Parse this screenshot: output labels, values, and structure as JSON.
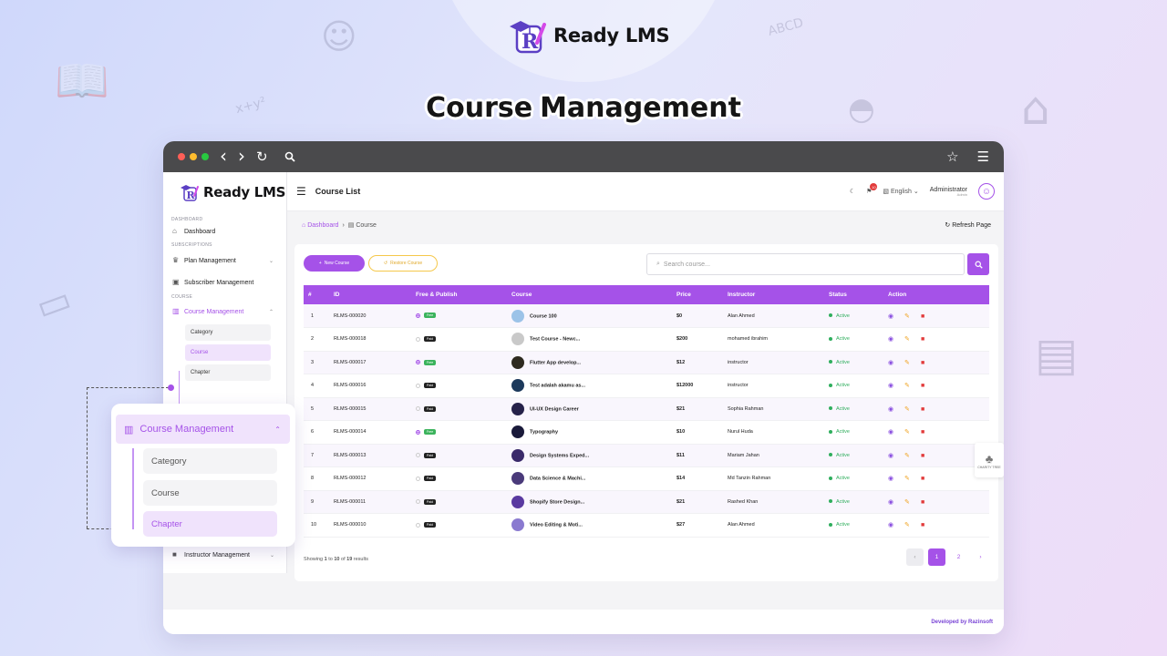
{
  "brand": {
    "name": "Ready LMS"
  },
  "hero": {
    "title_1": "Course",
    "title_2": "Management"
  },
  "browser": {
    "back": "‹",
    "forward": "›"
  },
  "sidebar": {
    "brand": "Ready LMS",
    "sections": {
      "dashboard": "DASHBOARD",
      "subscriptions": "SUBSCRIPTIONS",
      "course": "COURSE"
    },
    "items": {
      "dashboard": "Dashboard",
      "plan": "Plan Management",
      "subscriber": "Subscriber Management",
      "course_mgmt": "Course Management",
      "instructor": "Instructor Management"
    },
    "subitems": [
      "Category",
      "Course",
      "Chapter"
    ]
  },
  "topbar": {
    "title": "Course List",
    "notif_count": "10",
    "language": "English",
    "admin_name": "Administrator",
    "admin_role": "Admin"
  },
  "breadcrumb": {
    "home": "Dashboard",
    "current": "Course"
  },
  "refresh_label": "Refresh Page",
  "toolbar": {
    "new_course": "New Course",
    "restore_course": "Restore Course",
    "search_placeholder": "Search course..."
  },
  "table": {
    "headers": [
      "#",
      "ID",
      "Free & Publish",
      "Course",
      "Price",
      "Instructor",
      "Status",
      "Action"
    ],
    "rows": [
      {
        "n": "1",
        "id": "RLMS-000020",
        "publish": true,
        "pill": "Free",
        "course": "Course 100",
        "price": "$0",
        "instructor": "Alan Ahmed",
        "status": "Active"
      },
      {
        "n": "2",
        "id": "RLMS-000018",
        "publish": false,
        "pill": "Paid",
        "course": "Test Course - Newc...",
        "price": "$200",
        "instructor": "mohamed ibrahim",
        "status": "Active"
      },
      {
        "n": "3",
        "id": "RLMS-000017",
        "publish": true,
        "pill": "Free",
        "course": "Flutter App develop...",
        "price": "$12",
        "instructor": "instructor",
        "status": "Active"
      },
      {
        "n": "4",
        "id": "RLMS-000016",
        "publish": false,
        "pill": "Paid",
        "course": "Test adalah akamu as...",
        "price": "$12000",
        "instructor": "instructor",
        "status": "Active"
      },
      {
        "n": "5",
        "id": "RLMS-000015",
        "publish": false,
        "pill": "Paid",
        "course": "UI-UX Design Career",
        "price": "$21",
        "instructor": "Sophia Rahman",
        "status": "Active"
      },
      {
        "n": "6",
        "id": "RLMS-000014",
        "publish": true,
        "pill": "Free",
        "course": "Typography",
        "price": "$10",
        "instructor": "Nurul Huda",
        "status": "Active"
      },
      {
        "n": "7",
        "id": "RLMS-000013",
        "publish": false,
        "pill": "Paid",
        "course": "Design Systems Exped...",
        "price": "$11",
        "instructor": "Mariam Jahan",
        "status": "Active"
      },
      {
        "n": "8",
        "id": "RLMS-000012",
        "publish": false,
        "pill": "Paid",
        "course": "Data Science & Machi...",
        "price": "$14",
        "instructor": "Md Tanzin Rahman",
        "status": "Active"
      },
      {
        "n": "9",
        "id": "RLMS-000011",
        "publish": false,
        "pill": "Paid",
        "course": "Shopify Store Design...",
        "price": "$21",
        "instructor": "Rashed Khan",
        "status": "Active"
      },
      {
        "n": "10",
        "id": "RLMS-000010",
        "publish": false,
        "pill": "Paid",
        "course": "Video Editing & Moti...",
        "price": "$27",
        "instructor": "Alan Ahmed",
        "status": "Active"
      }
    ]
  },
  "pagination": {
    "showing_prefix": "Showing",
    "from": "1",
    "to_word": "to",
    "to": "10",
    "of_word": "of",
    "total": "19",
    "suffix": "results",
    "prev": "‹",
    "pages": [
      "1",
      "2"
    ],
    "next": "›"
  },
  "charity": {
    "label": "CHARITY TREE"
  },
  "footer": {
    "credit": "Developed by Razinsoft"
  },
  "zoom": {
    "title": "Course Management",
    "items": [
      "Category",
      "Course",
      "Chapter"
    ]
  },
  "colors": {
    "accent": "#a552e8",
    "success": "#2fae5d",
    "danger": "#e23b3b",
    "warning": "#f0a21f"
  }
}
